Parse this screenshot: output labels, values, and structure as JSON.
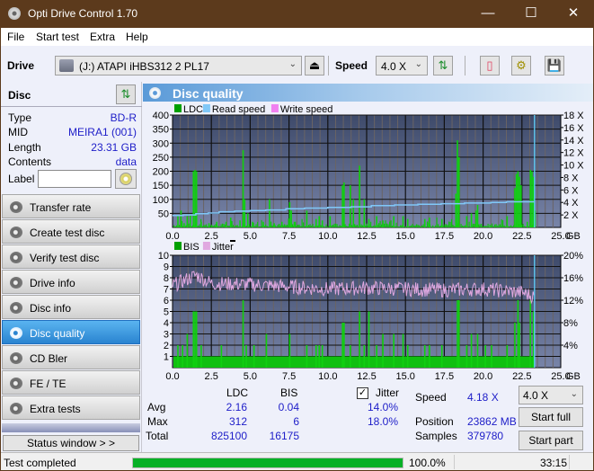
{
  "window": {
    "title": "Opti Drive Control 1.70",
    "minimize": "—",
    "maximize": "☐",
    "close": "✕"
  },
  "menu": [
    "File",
    "Start test",
    "Extra",
    "Help"
  ],
  "toolbar": {
    "drive_label": "Drive",
    "drive_value": "(J:)  ATAPI iHBS312   2 PL17",
    "speed_label": "Speed",
    "speed_value": "4.0 X",
    "icons": [
      "eject-icon",
      "refresh-icon",
      "erase-icon",
      "settings-icon",
      "save-icon"
    ]
  },
  "disc": {
    "header": "Disc",
    "rows": [
      {
        "key": "Type",
        "value": "BD-R"
      },
      {
        "key": "MID",
        "value": "MEIRA1 (001)"
      },
      {
        "key": "Length",
        "value": "23.31 GB"
      },
      {
        "key": "Contents",
        "value": "data"
      }
    ],
    "label_key": "Label",
    "label_value": ""
  },
  "nav": {
    "items": [
      {
        "label": "Transfer rate",
        "active": false
      },
      {
        "label": "Create test disc",
        "active": false
      },
      {
        "label": "Verify test disc",
        "active": false
      },
      {
        "label": "Drive info",
        "active": false
      },
      {
        "label": "Disc info",
        "active": false
      },
      {
        "label": "Disc quality",
        "active": true
      },
      {
        "label": "CD Bler",
        "active": false
      },
      {
        "label": "FE / TE",
        "active": false
      },
      {
        "label": "Extra tests",
        "active": false
      }
    ],
    "status_window": "Status window > >"
  },
  "main": {
    "title": "Disc quality"
  },
  "stats": {
    "col_ldc": "LDC",
    "col_bis": "BIS",
    "jitter_label": "Jitter",
    "jitter_checked": true,
    "rows": [
      {
        "label": "Avg",
        "ldc": "2.16",
        "bis": "0.04",
        "jitter": "14.0%"
      },
      {
        "label": "Max",
        "ldc": "312",
        "bis": "6",
        "jitter": "18.0%"
      },
      {
        "label": "Total",
        "ldc": "825100",
        "bis": "16175",
        "jitter": ""
      }
    ],
    "speed_label": "Speed",
    "speed_value": "4.18 X",
    "position_label": "Position",
    "position_value": "23862 MB",
    "samples_label": "Samples",
    "samples_value": "379780",
    "speed_select": "4.0 X",
    "start_full": "Start full",
    "start_part": "Start part"
  },
  "status": {
    "text": "Test completed",
    "progress": 1.0,
    "percent": "100.0%",
    "time": "33:15"
  },
  "chart_data": [
    {
      "type": "bar",
      "title": "LDC",
      "legend": [
        "LDC",
        "Read speed",
        "Write speed"
      ],
      "legend_colors": [
        "#00a000",
        "#80c8f8",
        "#f080f0"
      ],
      "legend_position": "top-left",
      "xlabel": "GB",
      "x_ticks": [
        "0.0",
        "2.5",
        "5.0",
        "7.5",
        "10.0",
        "12.5",
        "15.0",
        "17.5",
        "20.0",
        "22.5",
        "25.0"
      ],
      "y_ticks": [
        "50",
        "100",
        "150",
        "200",
        "250",
        "300",
        "350",
        "400"
      ],
      "y2_ticks": [
        "2 X",
        "4 X",
        "6 X",
        "8 X",
        "10 X",
        "12 X",
        "14 X",
        "16 X",
        "18 X"
      ],
      "xlim": [
        0,
        25
      ],
      "ylim": [
        0,
        400
      ],
      "y2lim": [
        0,
        18
      ],
      "grid": true,
      "end_marker_gb": 23.31,
      "ldc_spikes": [
        [
          0.3,
          40
        ],
        [
          0.5,
          60
        ],
        [
          0.7,
          15
        ],
        [
          0.9,
          40
        ],
        [
          1.1,
          45
        ],
        [
          1.3,
          200
        ],
        [
          1.4,
          205
        ],
        [
          1.5,
          200
        ],
        [
          1.8,
          20
        ],
        [
          2.3,
          15
        ],
        [
          2.8,
          20
        ],
        [
          3.4,
          20
        ],
        [
          3.7,
          35
        ],
        [
          4.3,
          25
        ],
        [
          4.5,
          275
        ],
        [
          4.6,
          100
        ],
        [
          4.8,
          50
        ],
        [
          5.1,
          20
        ],
        [
          5.8,
          20
        ],
        [
          6.2,
          100
        ],
        [
          6.5,
          15
        ],
        [
          7.0,
          20
        ],
        [
          7.5,
          90
        ],
        [
          7.6,
          60
        ],
        [
          7.8,
          20
        ],
        [
          8.6,
          60
        ],
        [
          9.2,
          30
        ],
        [
          9.4,
          40
        ],
        [
          9.6,
          25
        ],
        [
          10.1,
          40
        ],
        [
          10.9,
          150
        ],
        [
          11.0,
          160
        ],
        [
          11.4,
          150
        ],
        [
          11.6,
          100
        ],
        [
          12.0,
          220
        ],
        [
          12.3,
          100
        ],
        [
          12.6,
          30
        ],
        [
          13.1,
          40
        ],
        [
          13.5,
          25
        ],
        [
          14.2,
          40
        ],
        [
          14.8,
          40
        ],
        [
          15.1,
          30
        ],
        [
          16.2,
          30
        ],
        [
          16.5,
          35
        ],
        [
          17.3,
          30
        ],
        [
          18.2,
          120
        ],
        [
          18.3,
          310
        ],
        [
          18.4,
          250
        ],
        [
          18.9,
          40
        ],
        [
          19.2,
          50
        ],
        [
          19.5,
          60
        ],
        [
          19.6,
          80
        ],
        [
          20.4,
          10
        ],
        [
          21.5,
          40
        ],
        [
          22.0,
          140
        ],
        [
          22.1,
          190
        ],
        [
          22.2,
          200
        ],
        [
          22.3,
          180
        ],
        [
          22.4,
          150
        ],
        [
          22.8,
          20
        ],
        [
          23.0,
          205
        ],
        [
          23.1,
          200
        ],
        [
          23.2,
          180
        ],
        [
          23.3,
          60
        ]
      ],
      "read_speed": [
        [
          0.0,
          1.9
        ],
        [
          0.7,
          2.0
        ],
        [
          1.5,
          2.2
        ],
        [
          2.3,
          2.3
        ],
        [
          3.0,
          2.5
        ],
        [
          4.0,
          2.6
        ],
        [
          5.0,
          2.7
        ],
        [
          6.0,
          2.8
        ],
        [
          7.3,
          3.0
        ],
        [
          8.5,
          3.1
        ],
        [
          10.0,
          3.2
        ],
        [
          11.5,
          3.3
        ],
        [
          12.8,
          3.5
        ],
        [
          14.3,
          3.6
        ],
        [
          15.8,
          3.7
        ],
        [
          17.3,
          3.8
        ],
        [
          18.8,
          3.9
        ],
        [
          20.5,
          4.0
        ],
        [
          21.5,
          4.1
        ],
        [
          23.31,
          4.1
        ]
      ]
    },
    {
      "type": "bar",
      "title": "BIS",
      "legend": [
        "BIS",
        "Jitter"
      ],
      "legend_colors": [
        "#00a000",
        "#e0a8e0"
      ],
      "legend_position": "top-left",
      "xlabel": "GB",
      "x_ticks": [
        "0.0",
        "2.5",
        "5.0",
        "7.5",
        "10.0",
        "12.5",
        "15.0",
        "17.5",
        "20.0",
        "22.5",
        "25.0"
      ],
      "y_ticks": [
        "1",
        "2",
        "3",
        "4",
        "5",
        "6",
        "7",
        "8",
        "9",
        "10"
      ],
      "y2_ticks": [
        "4%",
        "8%",
        "12%",
        "16%",
        "20%"
      ],
      "xlim": [
        0,
        25
      ],
      "ylim": [
        0,
        10
      ],
      "y2lim": [
        0,
        20
      ],
      "grid": true,
      "end_marker_gb": 23.31,
      "bis_baseline": 1,
      "bis_spikes": [
        [
          0.3,
          2
        ],
        [
          0.6,
          2
        ],
        [
          0.9,
          3
        ],
        [
          1.3,
          5
        ],
        [
          1.4,
          5
        ],
        [
          1.5,
          5
        ],
        [
          1.8,
          2
        ],
        [
          3.1,
          2
        ],
        [
          4.5,
          6
        ],
        [
          4.7,
          2
        ],
        [
          5.2,
          2
        ],
        [
          6.0,
          3
        ],
        [
          7.5,
          3
        ],
        [
          8.6,
          2
        ],
        [
          9.2,
          2
        ],
        [
          9.4,
          2
        ],
        [
          9.6,
          2
        ],
        [
          10.9,
          4
        ],
        [
          11.0,
          4
        ],
        [
          11.4,
          2
        ],
        [
          12.0,
          5
        ],
        [
          12.3,
          2
        ],
        [
          12.6,
          5
        ],
        [
          13.1,
          2
        ],
        [
          13.5,
          3
        ],
        [
          14.2,
          3
        ],
        [
          14.8,
          3
        ],
        [
          15.1,
          2
        ],
        [
          16.2,
          2
        ],
        [
          16.5,
          2
        ],
        [
          17.3,
          2
        ],
        [
          18.3,
          6
        ],
        [
          18.4,
          6
        ],
        [
          18.9,
          2
        ],
        [
          19.2,
          3
        ],
        [
          19.6,
          3
        ],
        [
          20.1,
          2
        ],
        [
          20.5,
          2
        ],
        [
          21.5,
          2
        ],
        [
          22.0,
          4
        ],
        [
          22.2,
          6
        ],
        [
          22.3,
          4
        ],
        [
          23.0,
          6
        ],
        [
          23.2,
          5
        ]
      ],
      "jitter_profile": [
        [
          0.0,
          14.6
        ],
        [
          1.0,
          15.8
        ],
        [
          1.5,
          16.5
        ],
        [
          2.5,
          15.0
        ],
        [
          5.0,
          14.8
        ],
        [
          7.5,
          14.4
        ],
        [
          10.0,
          14.0
        ],
        [
          12.5,
          14.2
        ],
        [
          15.0,
          14.0
        ],
        [
          17.5,
          13.8
        ],
        [
          20.0,
          14.0
        ],
        [
          22.5,
          13.4
        ],
        [
          23.31,
          12.6
        ]
      ]
    }
  ]
}
